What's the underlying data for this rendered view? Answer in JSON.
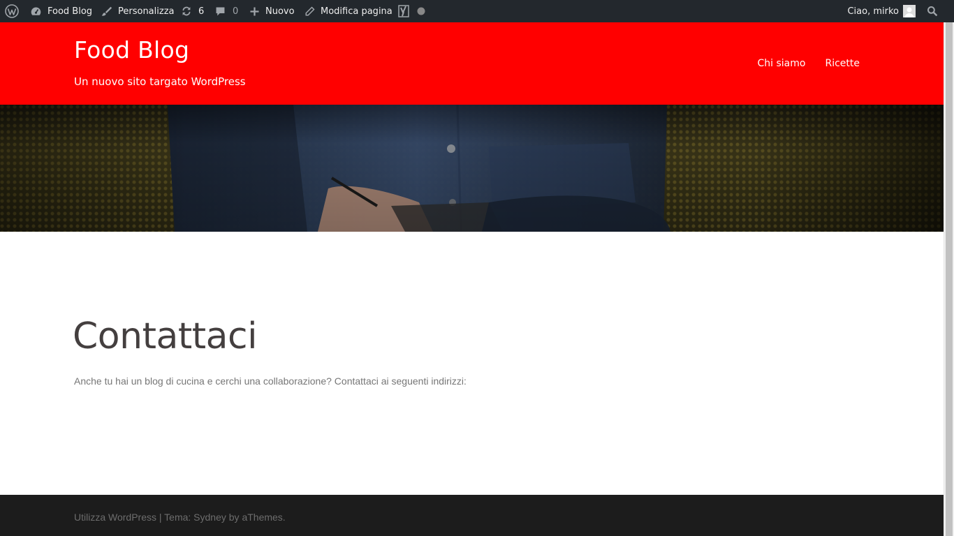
{
  "admin_bar": {
    "site_name": "Food Blog",
    "customize": "Personalizza",
    "updates_count": "6",
    "comments_count": "0",
    "new_label": "Nuovo",
    "edit_page": "Modifica pagina",
    "greeting": "Ciao, mirko"
  },
  "header": {
    "title": "Food Blog",
    "tagline": "Un nuovo sito targato WordPress",
    "nav": [
      "Chi siamo",
      "Ricette"
    ],
    "background_color": "#ff0000"
  },
  "content": {
    "title": "Contattaci",
    "text": "Anche tu hai un blog di cucina e cerchi una collaborazione? Contattaci ai seguenti indirizzi:"
  },
  "footer": {
    "powered": "Utilizza WordPress",
    "separator": " | ",
    "theme": "Tema: Sydney by aThemes."
  }
}
